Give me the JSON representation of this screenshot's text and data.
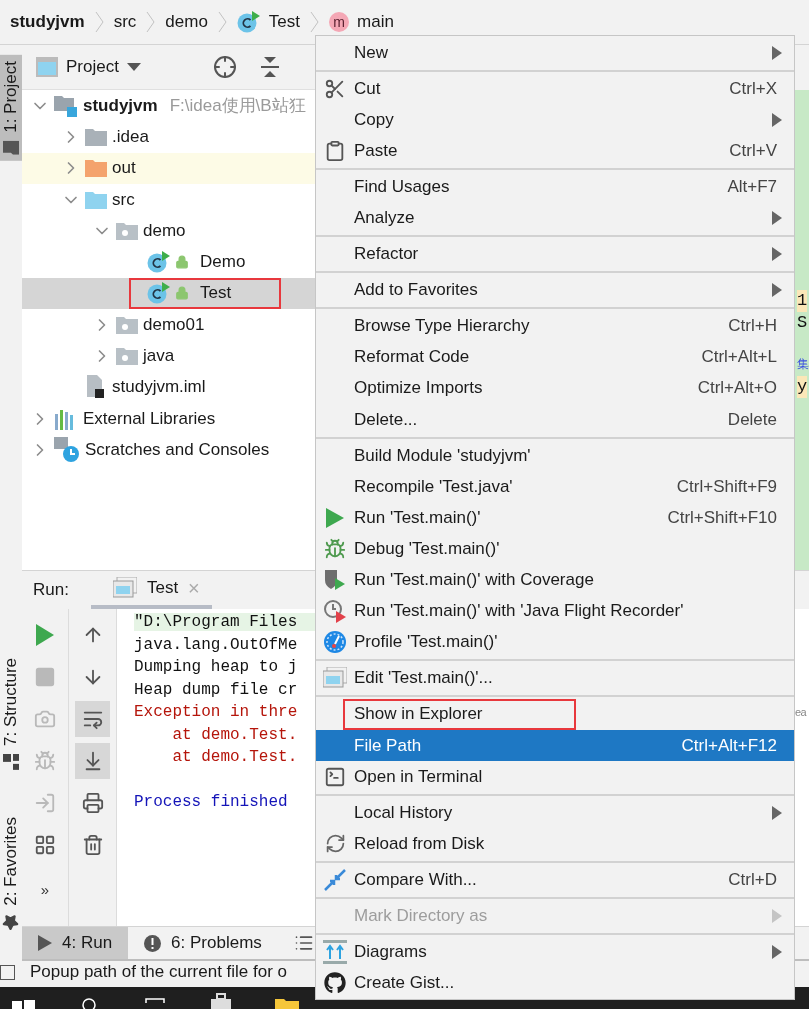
{
  "breadcrumb": [
    {
      "label": "studyjvm",
      "kind": "module"
    },
    {
      "label": "src",
      "kind": "folder"
    },
    {
      "label": "demo",
      "kind": "folder"
    },
    {
      "label": "Test",
      "kind": "class"
    },
    {
      "label": "main",
      "kind": "method",
      "badge": "m"
    }
  ],
  "stripe": {
    "top": [
      {
        "label": "1: Project",
        "selected": true
      }
    ],
    "bottom": [
      {
        "label": "7: Structure",
        "selected": false
      },
      {
        "label": "2: Favorites",
        "selected": false
      }
    ]
  },
  "project": {
    "title": "Project",
    "tree": [
      {
        "label": "studyjvm",
        "kind": "module",
        "hint": "F:\\idea使用\\B站狂",
        "expanded": true,
        "selected": false,
        "children": [
          {
            "label": ".idea",
            "kind": "folder",
            "expanded": false,
            "selected": false
          },
          {
            "label": "out",
            "kind": "excluded-folder",
            "expanded": false,
            "selected": false
          },
          {
            "label": "src",
            "kind": "source-folder",
            "expanded": true,
            "selected": false,
            "children": [
              {
                "label": "demo",
                "kind": "package",
                "expanded": true,
                "selected": false,
                "children": [
                  {
                    "label": "Demo",
                    "kind": "class",
                    "selected": false
                  },
                  {
                    "label": "Test",
                    "kind": "class",
                    "selected": true,
                    "outlined": true
                  }
                ]
              },
              {
                "label": "demo01",
                "kind": "package",
                "expanded": false,
                "selected": false
              },
              {
                "label": "java",
                "kind": "package",
                "expanded": false,
                "selected": false
              }
            ]
          },
          {
            "label": "studyjvm.iml",
            "kind": "file",
            "selected": false
          }
        ]
      },
      {
        "label": "External Libraries",
        "kind": "libraries",
        "expanded": false,
        "selected": false
      },
      {
        "label": "Scratches and Consoles",
        "kind": "scratches",
        "expanded": false,
        "selected": false
      }
    ]
  },
  "editor": {
    "lines": [
      {
        "text": "1",
        "kind": "highlighted"
      },
      {
        "text": "S",
        "kind": "normal"
      },
      {
        "text": "集",
        "kind": "link"
      },
      {
        "text": "y",
        "kind": "highlighted"
      }
    ]
  },
  "run": {
    "title": "Run:",
    "tab": "Test",
    "close": "×",
    "actions": [
      {
        "disabled": false
      },
      {
        "disabled": true
      },
      {
        "disabled": true
      },
      {
        "disabled": true
      },
      {
        "disabled": true
      },
      {
        "disabled": false
      }
    ],
    "more": "»",
    "tools": [
      {
        "on": false
      },
      {
        "on": false
      },
      {
        "on": true
      },
      {
        "on": true
      },
      {
        "on": false
      },
      {
        "on": false
      }
    ],
    "console": [
      {
        "text": "\"D:\\Program Files",
        "kind": "command"
      },
      {
        "text": "java.lang.OutOfMe",
        "kind": "normal"
      },
      {
        "text": "Dumping heap to j",
        "kind": "normal"
      },
      {
        "text": "Heap dump file cr",
        "kind": "normal"
      },
      {
        "text": "Exception in thre",
        "kind": "error",
        "tail": "ea"
      },
      {
        "text": "    at demo.Test.",
        "kind": "error"
      },
      {
        "text": "    at demo.Test.",
        "kind": "error"
      },
      {
        "text": "Process finished",
        "kind": "info"
      }
    ]
  },
  "bottom_tabs": [
    {
      "label": "4: Run",
      "selected": true
    },
    {
      "label": "6: Problems",
      "selected": false
    },
    {
      "selected": false
    }
  ],
  "status_bar": {
    "text": "Popup path of the current file for o"
  },
  "menu": {
    "groups": [
      {
        "items": [
          {
            "label": "New",
            "submenu": true,
            "selected": false
          }
        ]
      },
      {
        "items": [
          {
            "label": "Cut",
            "shortcut": "Ctrl+X",
            "selected": false
          },
          {
            "label": "Copy",
            "submenu": true,
            "selected": false
          },
          {
            "label": "Paste",
            "shortcut": "Ctrl+V",
            "selected": false
          }
        ]
      },
      {
        "items": [
          {
            "label": "Find Usages",
            "shortcut": "Alt+F7",
            "selected": false
          },
          {
            "label": "Analyze",
            "submenu": true,
            "selected": false
          }
        ]
      },
      {
        "items": [
          {
            "label": "Refactor",
            "submenu": true,
            "selected": false
          }
        ]
      },
      {
        "items": [
          {
            "label": "Add to Favorites",
            "submenu": true,
            "selected": false
          }
        ]
      },
      {
        "items": [
          {
            "label": "Browse Type Hierarchy",
            "shortcut": "Ctrl+H",
            "selected": false
          },
          {
            "label": "Reformat Code",
            "shortcut": "Ctrl+Alt+L",
            "selected": false
          },
          {
            "label": "Optimize Imports",
            "shortcut": "Ctrl+Alt+O",
            "selected": false
          },
          {
            "label": "Delete...",
            "shortcut": "Delete",
            "selected": false
          }
        ]
      },
      {
        "items": [
          {
            "label": "Build Module 'studyjvm'",
            "selected": false
          },
          {
            "label": "Recompile 'Test.java'",
            "shortcut": "Ctrl+Shift+F9",
            "selected": false
          },
          {
            "label": "Run 'Test.main()'",
            "shortcut": "Ctrl+Shift+F10",
            "selected": false
          },
          {
            "label": "Debug 'Test.main()'",
            "selected": false
          },
          {
            "label": "Run 'Test.main()' with Coverage",
            "selected": false
          },
          {
            "label": "Run 'Test.main()' with 'Java Flight Recorder'",
            "selected": false
          },
          {
            "label": "Profile 'Test.main()'",
            "selected": false
          }
        ]
      },
      {
        "items": [
          {
            "label": "Edit 'Test.main()'...",
            "selected": false
          }
        ]
      },
      {
        "items": [
          {
            "label": "Show in Explorer",
            "selected": false,
            "outlined": true
          },
          {
            "label": "File Path",
            "shortcut": "Ctrl+Alt+F12",
            "selected": true
          },
          {
            "label": "Open in Terminal",
            "selected": false
          }
        ]
      },
      {
        "items": [
          {
            "label": "Local History",
            "submenu": true,
            "selected": false
          },
          {
            "label": "Reload from Disk",
            "selected": false
          }
        ]
      },
      {
        "items": [
          {
            "label": "Compare With...",
            "shortcut": "Ctrl+D",
            "selected": false
          }
        ]
      },
      {
        "items": [
          {
            "label": "Mark Directory as",
            "submenu": true,
            "disabled": true,
            "selected": false
          }
        ]
      },
      {
        "items": [
          {
            "label": "Diagrams",
            "submenu": true,
            "selected": false
          },
          {
            "label": "Create Gist...",
            "selected": false
          }
        ]
      }
    ]
  }
}
